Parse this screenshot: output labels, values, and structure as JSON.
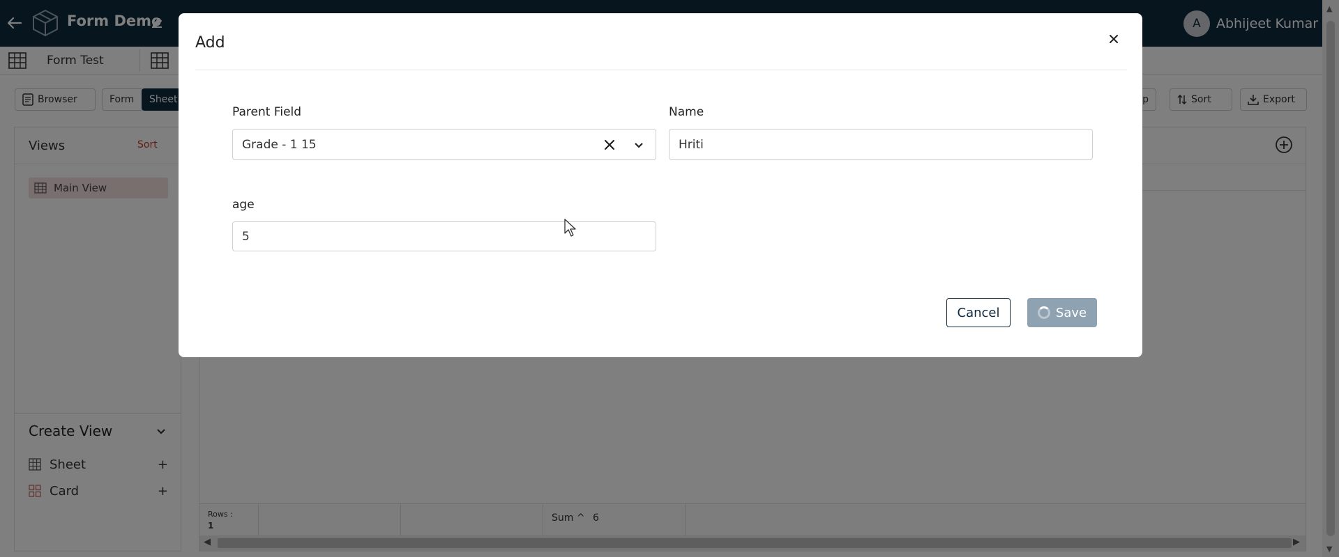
{
  "topbar": {
    "title": "Form Demo",
    "user_initial": "A",
    "user_name": "Abhijeet Kumar"
  },
  "tabs": {
    "first_label": "Form Test"
  },
  "toolbar": {
    "browser": "Browser",
    "form": "Form",
    "sheet": "Sheet",
    "group_partial": "p",
    "sort": "Sort",
    "export": "Export"
  },
  "views": {
    "title": "Views",
    "sort": "Sort",
    "main_view": "Main View"
  },
  "create_view": {
    "title": "Create View",
    "items": [
      {
        "label": "Sheet",
        "plus": "+"
      },
      {
        "label": "Card",
        "plus": "+"
      }
    ]
  },
  "grid_footer": {
    "rows_label": "Rows :",
    "rows_count": "1",
    "sum_label": "Sum ^",
    "sum_value": "6"
  },
  "modal": {
    "title": "Add",
    "parent_field": {
      "label": "Parent Field",
      "value": "Grade - 1 15"
    },
    "name": {
      "label": "Name",
      "value": "Hriti"
    },
    "age": {
      "label": "age",
      "value": "5"
    },
    "cancel": "Cancel",
    "save": "Save"
  },
  "colors": {
    "navy": "#0f2a3e",
    "save_disabled": "#8ea2b2",
    "main_view_bg": "#f4dede",
    "sort_red": "#c0392b"
  }
}
